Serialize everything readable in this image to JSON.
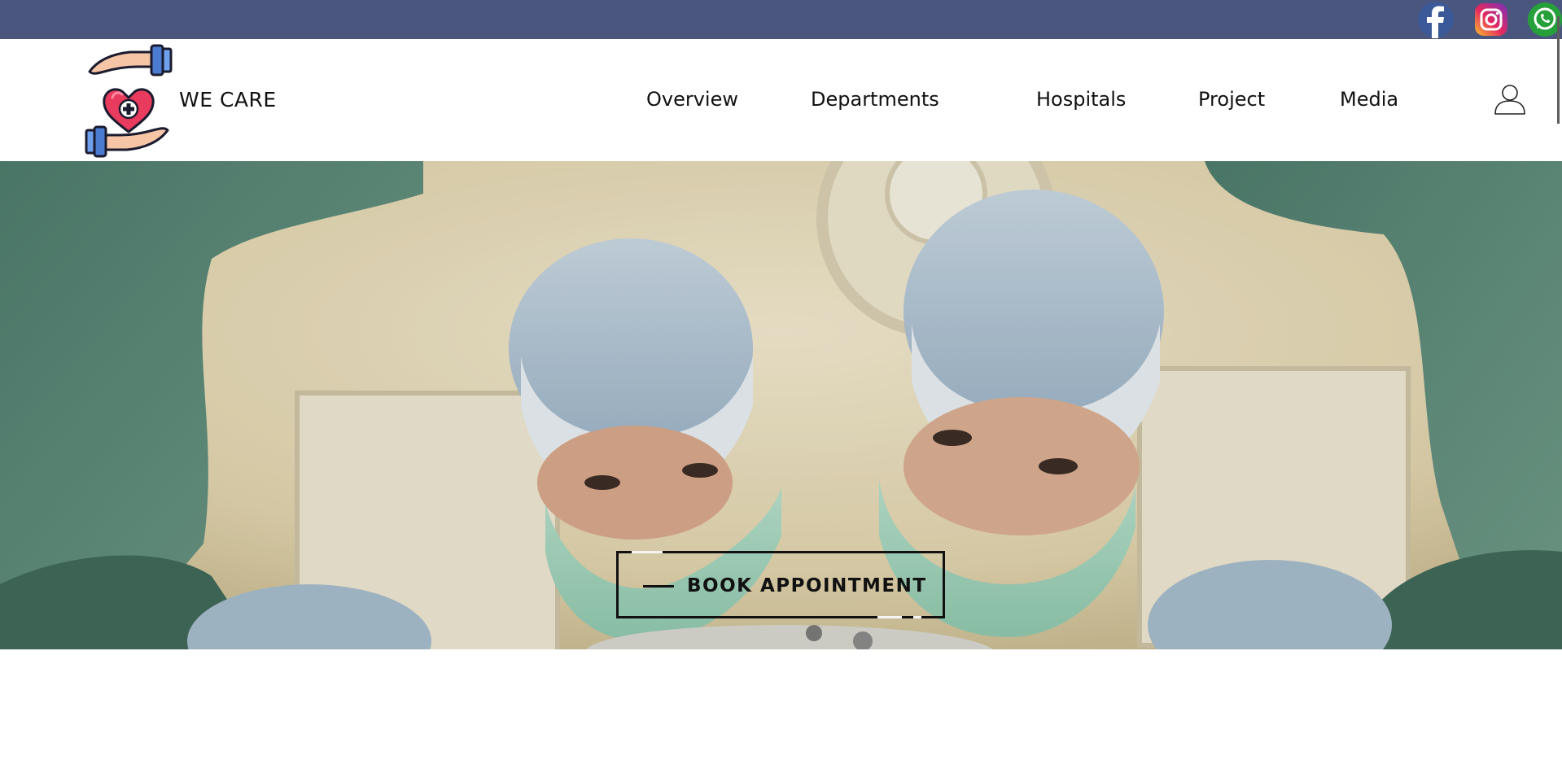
{
  "topbar": {
    "social": [
      "facebook-icon",
      "instagram-icon",
      "whatsapp-icon"
    ],
    "colors": {
      "bar": "#4b567e",
      "facebook": "#3b5998",
      "whatsapp": "#25a03a"
    }
  },
  "header": {
    "brand": "WE CARE",
    "nav": [
      "Overview",
      "Departments",
      "Hospitals",
      "Project",
      "Media"
    ],
    "user_icon": "user-icon"
  },
  "hero": {
    "cta_label": "BOOK APPOINTMENT"
  }
}
